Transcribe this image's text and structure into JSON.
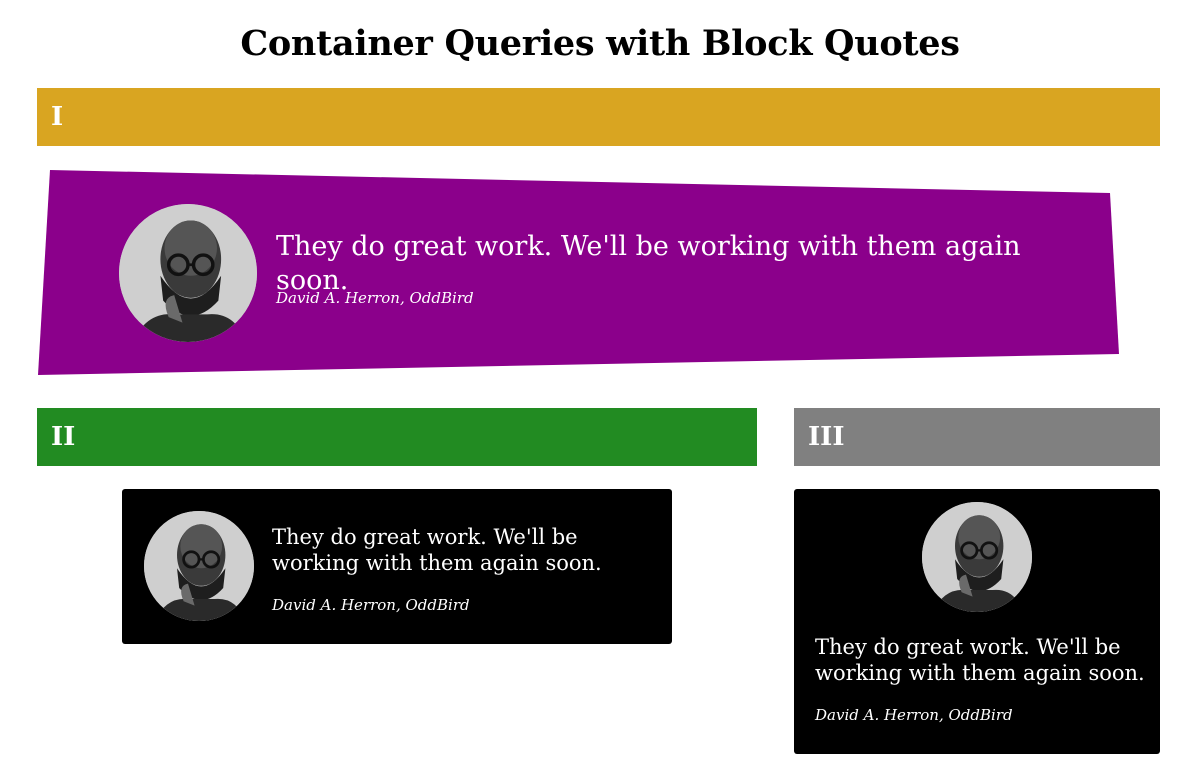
{
  "page": {
    "title": "Container Queries with Block Quotes"
  },
  "sections": [
    {
      "label": "I",
      "color": "#d9a521"
    },
    {
      "label": "II",
      "color": "#228b22"
    },
    {
      "label": "III",
      "color": "#808080"
    }
  ],
  "quotes": [
    {
      "text": "They do great work. We'll be working with them again soon.",
      "cite": "David A. Herron, OddBird",
      "background": "#8b008b",
      "avatar_icon": "person-portrait-icon"
    },
    {
      "text": "They do great work. We'll be working with them again soon.",
      "cite": "David A. Herron, OddBird",
      "background": "#000000",
      "avatar_icon": "person-portrait-icon"
    },
    {
      "text": "They do great work. We'll be working with them again soon.",
      "cite": "David A. Herron, OddBird",
      "background": "#000000",
      "avatar_icon": "person-portrait-icon"
    }
  ]
}
